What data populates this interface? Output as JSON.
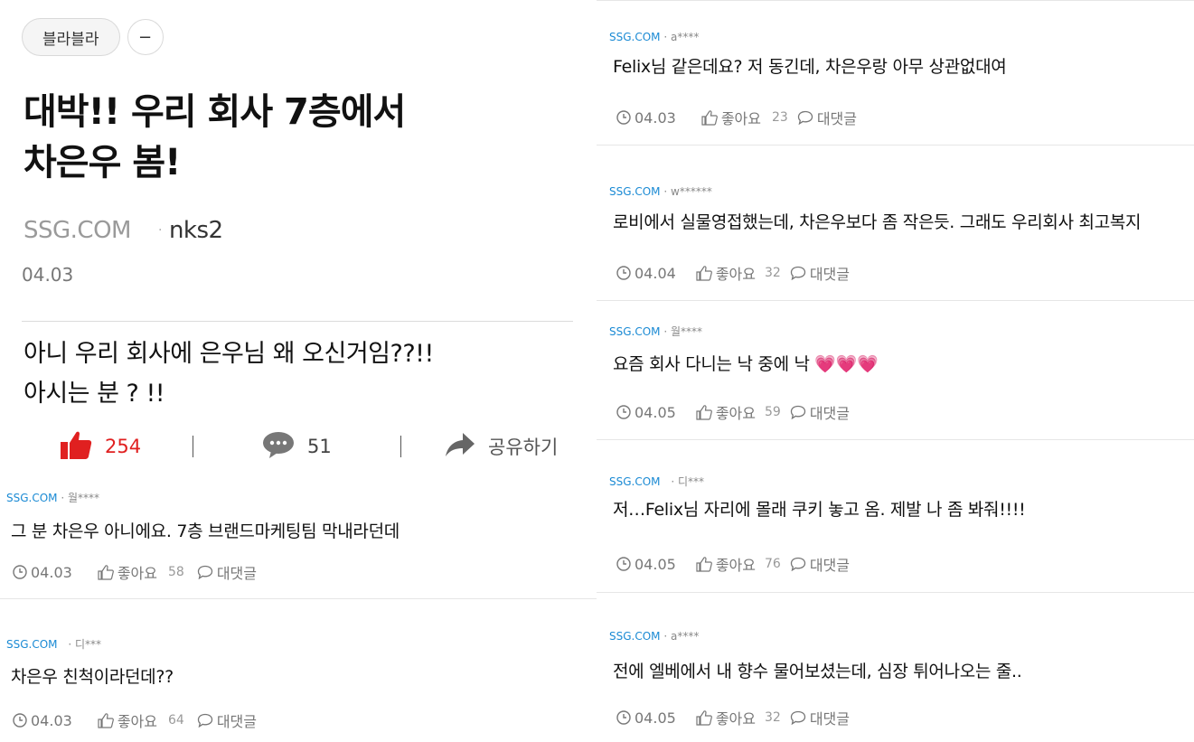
{
  "post": {
    "tag": "블라블라",
    "tag_more": "−",
    "title_line1": "대박!! 우리 회사 7층에서",
    "title_line2": "차은우 봄!",
    "source": "SSG.COM",
    "author": "nks2",
    "date": "04.03",
    "body_line1": "아니 우리 회사에 은우님 왜 오신거임??!!",
    "body_line2": "아시는 분 ? !!",
    "likes": "254",
    "comments": "51",
    "share_label": "공유하기"
  },
  "labels": {
    "like": "좋아요",
    "reply": "대댓글",
    "dot": "·"
  },
  "colors": {
    "like_red": "#e02020",
    "source_blue": "#1a8ad4"
  },
  "comments_left": [
    {
      "source": "SSG.COM",
      "author": "월****",
      "text": "그 분 차은우 아니에요. 7층 브랜드마케팅팀 막내라던데",
      "date": "04.03",
      "likes": "58"
    },
    {
      "source": "SSG.COM",
      "author": "디***",
      "text": "차은우 친척이라던데??",
      "date": "04.03",
      "likes": "64"
    }
  ],
  "comments_right": [
    {
      "source": "SSG.COM",
      "author": "a****",
      "text": "Felix님 같은데요? 저 동긴데, 차은우랑 아무 상관없대여",
      "date": "04.03",
      "likes": "23"
    },
    {
      "source": "SSG.COM",
      "author": "w******",
      "text": "로비에서 실물영접했는데, 차은우보다 좀 작은듯. 그래도 우리회사 최고복지",
      "date": "04.04",
      "likes": "32"
    },
    {
      "source": "SSG.COM",
      "author": "월****",
      "text": "요즘 회사 다니는 낙 중에 낙 💗💗💗",
      "date": "04.05",
      "likes": "59"
    },
    {
      "source": "SSG.COM",
      "author": "디***",
      "text": "저…Felix님 자리에 몰래 쿠키 놓고 옴. 제발 나 좀 봐줘!!!!",
      "date": "04.05",
      "likes": "76"
    },
    {
      "source": "SSG.COM",
      "author": "a****",
      "text": "전에 엘베에서 내 향수 물어보셨는데, 심장 튀어나오는 줄..",
      "date": "04.05",
      "likes": "32"
    }
  ]
}
